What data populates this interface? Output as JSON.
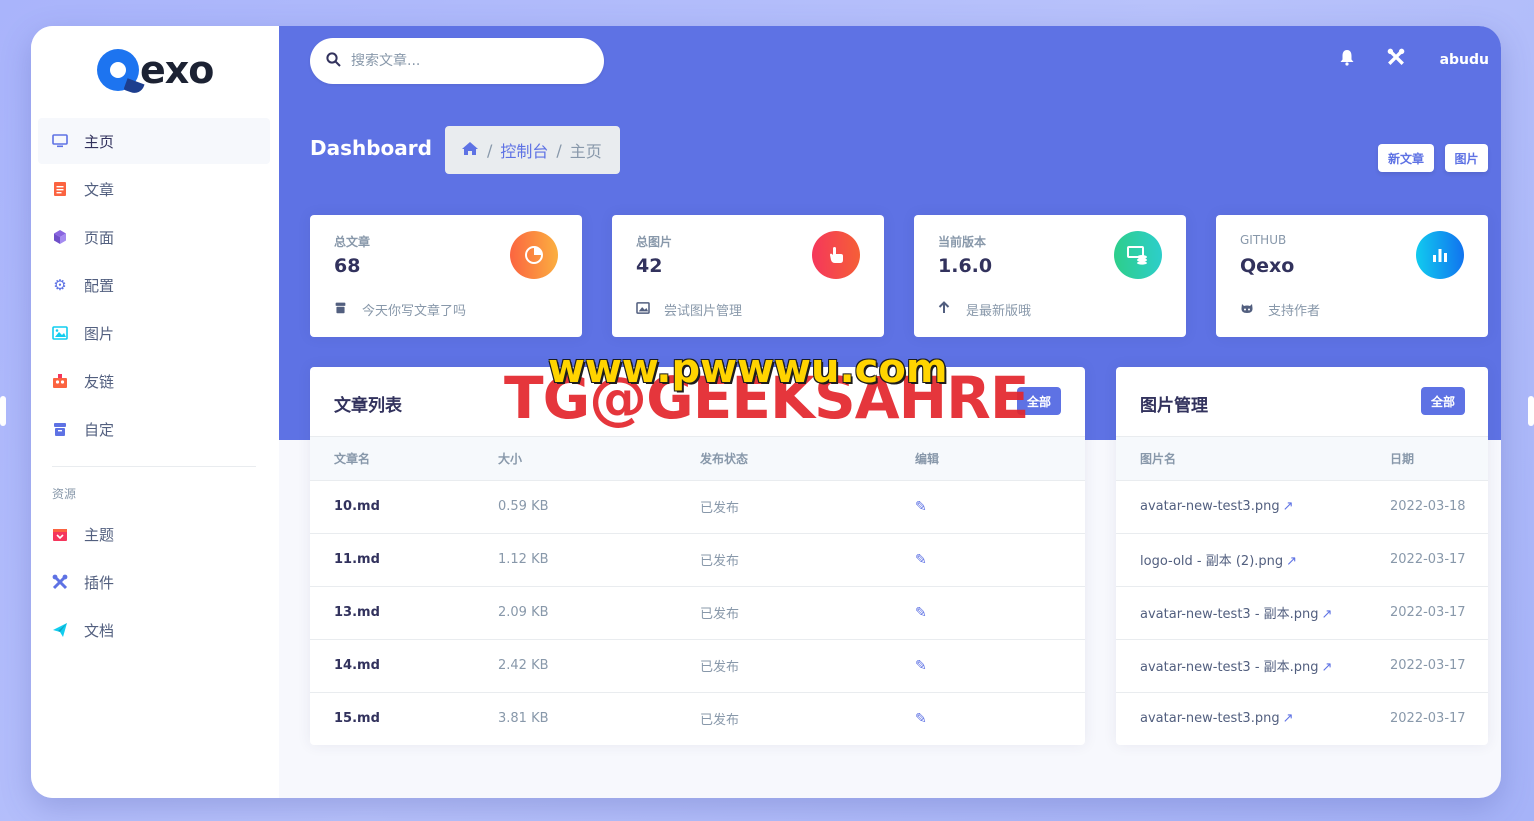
{
  "app": {
    "logo_text": "exo",
    "logo_full": "Qexo"
  },
  "sidebar": {
    "items": [
      {
        "label": "主页",
        "icon": "monitor-icon",
        "active": true
      },
      {
        "label": "文章",
        "icon": "document-icon"
      },
      {
        "label": "页面",
        "icon": "cube-icon"
      },
      {
        "label": "配置",
        "icon": "gear-icon"
      },
      {
        "label": "图片",
        "icon": "image-icon"
      },
      {
        "label": "友链",
        "icon": "friends-icon"
      },
      {
        "label": "自定",
        "icon": "archive-icon"
      }
    ],
    "resources_heading": "资源",
    "resources": [
      {
        "label": "主题",
        "icon": "theme-icon"
      },
      {
        "label": "插件",
        "icon": "tools-icon"
      },
      {
        "label": "文档",
        "icon": "paper-plane-icon"
      }
    ]
  },
  "header": {
    "search_placeholder": "搜索文章...",
    "username": "abudu",
    "icons": [
      "bell-icon",
      "tools-icon"
    ]
  },
  "page": {
    "title": "Dashboard",
    "breadcrumb": [
      "控制台",
      "主页"
    ],
    "buttons": {
      "new_post": "新文章",
      "images": "图片"
    }
  },
  "stats": [
    {
      "label": "总文章",
      "value": "68",
      "footer": "今天你写文章了吗",
      "icon": "pie-chart-icon",
      "color": "#fb6340",
      "foot_icon": "archive-icon"
    },
    {
      "label": "总图片",
      "value": "42",
      "footer": "尝试图片管理",
      "icon": "hand-pointer-icon",
      "color": "#f5365c",
      "foot_icon": "images-icon"
    },
    {
      "label": "当前版本",
      "value": "1.6.0",
      "footer": "是最新版哦",
      "icon": "money-coins-icon",
      "color": "#2dce89",
      "foot_icon": "arrow-up-icon"
    },
    {
      "label": "GITHUB",
      "value": "Qexo",
      "footer": "支持作者",
      "icon": "bar-chart-icon",
      "color": "#11cdef",
      "foot_icon": "github-icon"
    }
  ],
  "posts": {
    "title": "文章列表",
    "button": "全部",
    "columns": [
      "文章名",
      "大小",
      "发布状态",
      "编辑"
    ],
    "rows": [
      {
        "name": "10.md",
        "size": "0.59 KB",
        "status": "已发布"
      },
      {
        "name": "11.md",
        "size": "1.12 KB",
        "status": "已发布"
      },
      {
        "name": "13.md",
        "size": "2.09 KB",
        "status": "已发布"
      },
      {
        "name": "14.md",
        "size": "2.42 KB",
        "status": "已发布"
      },
      {
        "name": "15.md",
        "size": "3.81 KB",
        "status": "已发布"
      }
    ]
  },
  "images": {
    "title": "图片管理",
    "button": "全部",
    "columns": [
      "图片名",
      "日期"
    ],
    "rows": [
      {
        "name": "avatar-new-test3.png",
        "date": "2022-03-18"
      },
      {
        "name": "logo-old - 副本 (2).png",
        "date": "2022-03-17"
      },
      {
        "name": "avatar-new-test3 - 副本.png",
        "date": "2022-03-17"
      },
      {
        "name": "avatar-new-test3 - 副本.png",
        "date": "2022-03-17"
      },
      {
        "name": "avatar-new-test3.png",
        "date": "2022-03-17"
      }
    ]
  },
  "watermark": {
    "red": "TG@GEEKSAHRE",
    "yellow": "www.pwwwu.com"
  },
  "colors": {
    "primary": "#5e72e4",
    "orange": "#fb6340",
    "red": "#f5365c",
    "green": "#2dce89",
    "cyan": "#11cdef"
  }
}
